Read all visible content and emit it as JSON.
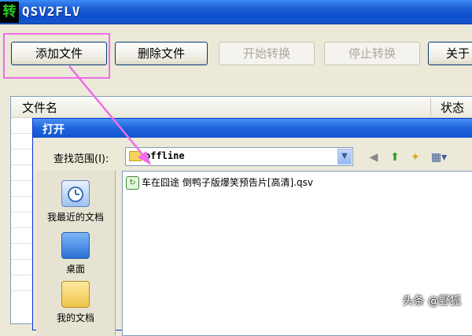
{
  "window": {
    "icon_glyph": "转",
    "title": "QSV2FLV"
  },
  "toolbar": {
    "add": "添加文件",
    "delete": "删除文件",
    "start": "开始转换",
    "stop": "停止转换",
    "about": "关于"
  },
  "list": {
    "col_name": "文件名",
    "col_status": "状态"
  },
  "dialog": {
    "title": "打开",
    "lookin_label": "查找范围(I):",
    "lookin_value": "offline",
    "places": [
      {
        "label": "我最近的文档",
        "icon": "recent-docs-icon"
      },
      {
        "label": "桌面",
        "icon": "desktop-icon"
      },
      {
        "label": "我的文档",
        "icon": "my-docs-icon"
      }
    ],
    "files": [
      {
        "name": "车在囧途 倒鸭子版爆笑预告片[高清].qsv",
        "icon": "qsv-file-icon"
      }
    ]
  },
  "watermark": "头条 @野狐",
  "colors": {
    "title_blue": "#1f5fd6",
    "highlight_pink": "#f06ce8"
  }
}
